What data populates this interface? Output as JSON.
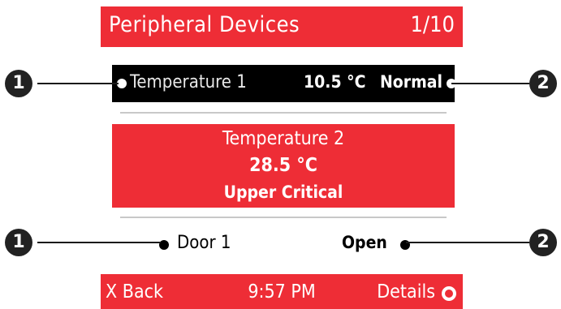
{
  "header": {
    "title": "Peripheral Devices",
    "page_indicator": "1/10"
  },
  "devices": [
    {
      "name": "Temperature 1",
      "value": "10.5 °C",
      "status": "Normal",
      "state": "selected"
    },
    {
      "name": "Temperature 2",
      "value": "28.5 °C",
      "status": "Upper Critical",
      "state": "alarm"
    },
    {
      "name": "Door 1",
      "status": "Open",
      "state": "normal"
    }
  ],
  "footer": {
    "back_label": "X Back",
    "time": "9:57 PM",
    "details_label": "Details"
  },
  "callouts": {
    "left_marker": "1",
    "right_marker": "2"
  },
  "colors": {
    "accent_red": "#ee2d36",
    "selected_bg": "#000000",
    "callout": "#222222"
  },
  "icons": {
    "details": "ring-icon",
    "marker": "dot-icon"
  }
}
